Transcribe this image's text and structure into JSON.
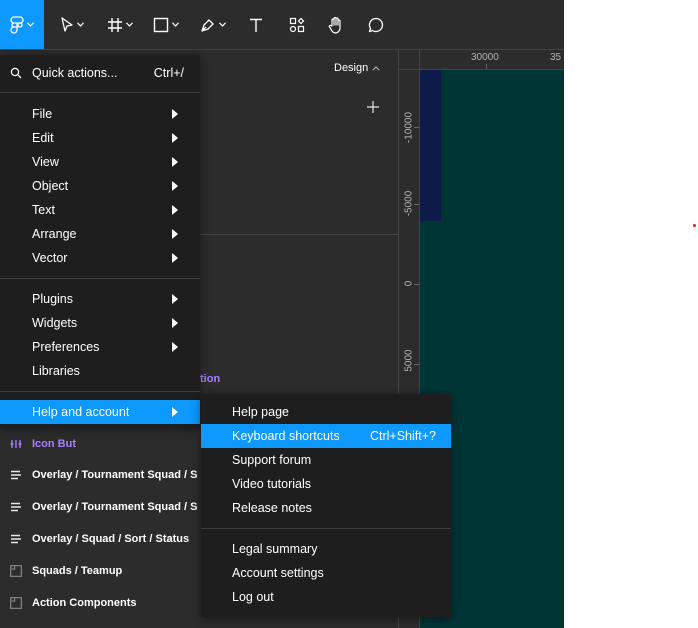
{
  "panel": {
    "design_tab": "Design"
  },
  "ruler": {
    "top_ticks": [
      "30000",
      "35"
    ],
    "left_ticks": [
      "-10000",
      "-5000",
      "0",
      "5000"
    ]
  },
  "canvas": {
    "background": "#003536",
    "accent": "#0d99ff"
  },
  "menu": {
    "quick_actions": {
      "label": "Quick actions...",
      "shortcut": "Ctrl+/"
    },
    "items_group1": [
      "File",
      "Edit",
      "View",
      "Object",
      "Text",
      "Arrange",
      "Vector"
    ],
    "items_group2": [
      "Plugins",
      "Widgets",
      "Preferences",
      "Libraries"
    ],
    "help": "Help and account"
  },
  "submenu": {
    "help_page": "Help page",
    "keyboard_shortcuts": {
      "label": "Keyboard shortcuts",
      "shortcut": "Ctrl+Shift+?"
    },
    "support_forum": "Support forum",
    "video_tutorials": "Video tutorials",
    "release_notes": "Release notes",
    "legal_summary": "Legal summary",
    "account_settings": "Account settings",
    "log_out": "Log out"
  },
  "layers": {
    "partial_label": "tion",
    "items": [
      {
        "label": "Icon But",
        "icon": "component-icon"
      },
      {
        "label": "Overlay / Tournament Squad / S",
        "icon": "autolayout-icon"
      },
      {
        "label": "Overlay / Tournament Squad / S",
        "icon": "autolayout-icon"
      },
      {
        "label": "Overlay / Squad / Sort / Status",
        "icon": "autolayout-icon"
      },
      {
        "label": "Squads / Teamup",
        "icon": "frame-icon"
      },
      {
        "label": "Action Components",
        "icon": "frame-icon"
      }
    ]
  }
}
